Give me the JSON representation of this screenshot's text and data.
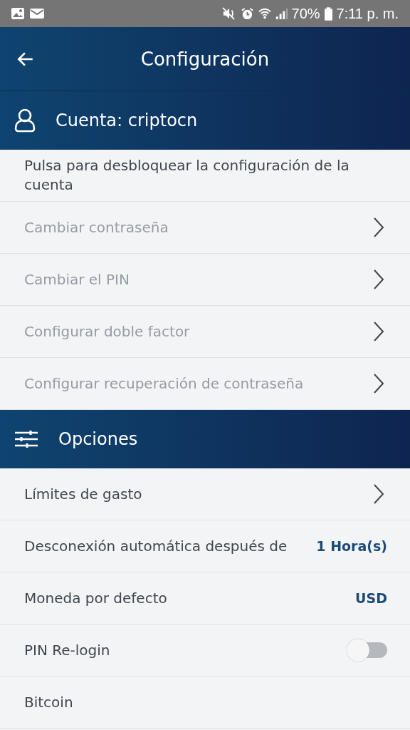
{
  "status_bar": {
    "battery": "70%",
    "time": "7:11 p. m."
  },
  "header": {
    "title": "Configuración"
  },
  "sections": [
    {
      "kind": "account",
      "title": "Cuenta: criptocn",
      "items": [
        {
          "kind": "note",
          "label": "Pulsa para desbloquear la configuración de la cuenta",
          "disabled": false
        },
        {
          "kind": "link",
          "label": "Cambiar contraseña",
          "disabled": true
        },
        {
          "kind": "link",
          "label": "Cambiar el PIN",
          "disabled": true
        },
        {
          "kind": "link",
          "label": "Configurar doble factor",
          "disabled": true
        },
        {
          "kind": "link",
          "label": "Configurar recuperación de contraseña",
          "disabled": true
        }
      ]
    },
    {
      "kind": "options",
      "title": "Opciones",
      "items": [
        {
          "kind": "link",
          "label": "Límites de gasto",
          "disabled": false
        },
        {
          "kind": "value",
          "label": "Desconexión automática después de",
          "value": "1 Hora(s)",
          "disabled": false
        },
        {
          "kind": "value",
          "label": "Moneda por defecto",
          "value": "USD",
          "disabled": false
        },
        {
          "kind": "toggle",
          "label": "PIN Re-login",
          "on": false,
          "disabled": false
        },
        {
          "kind": "plain",
          "label": "Bitcoin",
          "disabled": false
        }
      ]
    }
  ]
}
